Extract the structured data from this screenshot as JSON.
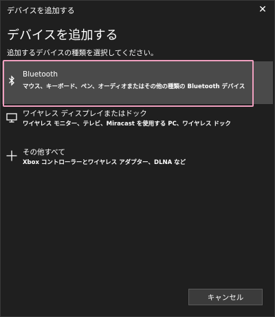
{
  "window": {
    "title": "デバイスを追加する",
    "close_glyph": "✕"
  },
  "dialog": {
    "heading": "デバイスを追加する",
    "subheading": "追加するデバイスの種類を選択してください。",
    "options": [
      {
        "icon": "bluetooth-icon",
        "title": "Bluetooth",
        "description": "マウス、キーボード、ペン、オーディオまたはその他の種類の Bluetooth デバイス",
        "selected": true
      },
      {
        "icon": "monitor-icon",
        "title": "ワイヤレス ディスプレイまたはドック",
        "description": "ワイヤレス モニター、テレビ、Miracast を使用する PC、ワイヤレス ドック",
        "selected": false
      },
      {
        "icon": "plus-icon",
        "title": "その他すべて",
        "description": "Xbox コントローラーとワイヤレス アダプター、DLNA など",
        "selected": false
      }
    ],
    "cancel_label": "キャンセル"
  },
  "colors": {
    "background": "#1f1f1f",
    "selected_row": "#4a4a4a",
    "highlight_border": "#f0a0c0",
    "button_bg": "#3b3b3b"
  }
}
